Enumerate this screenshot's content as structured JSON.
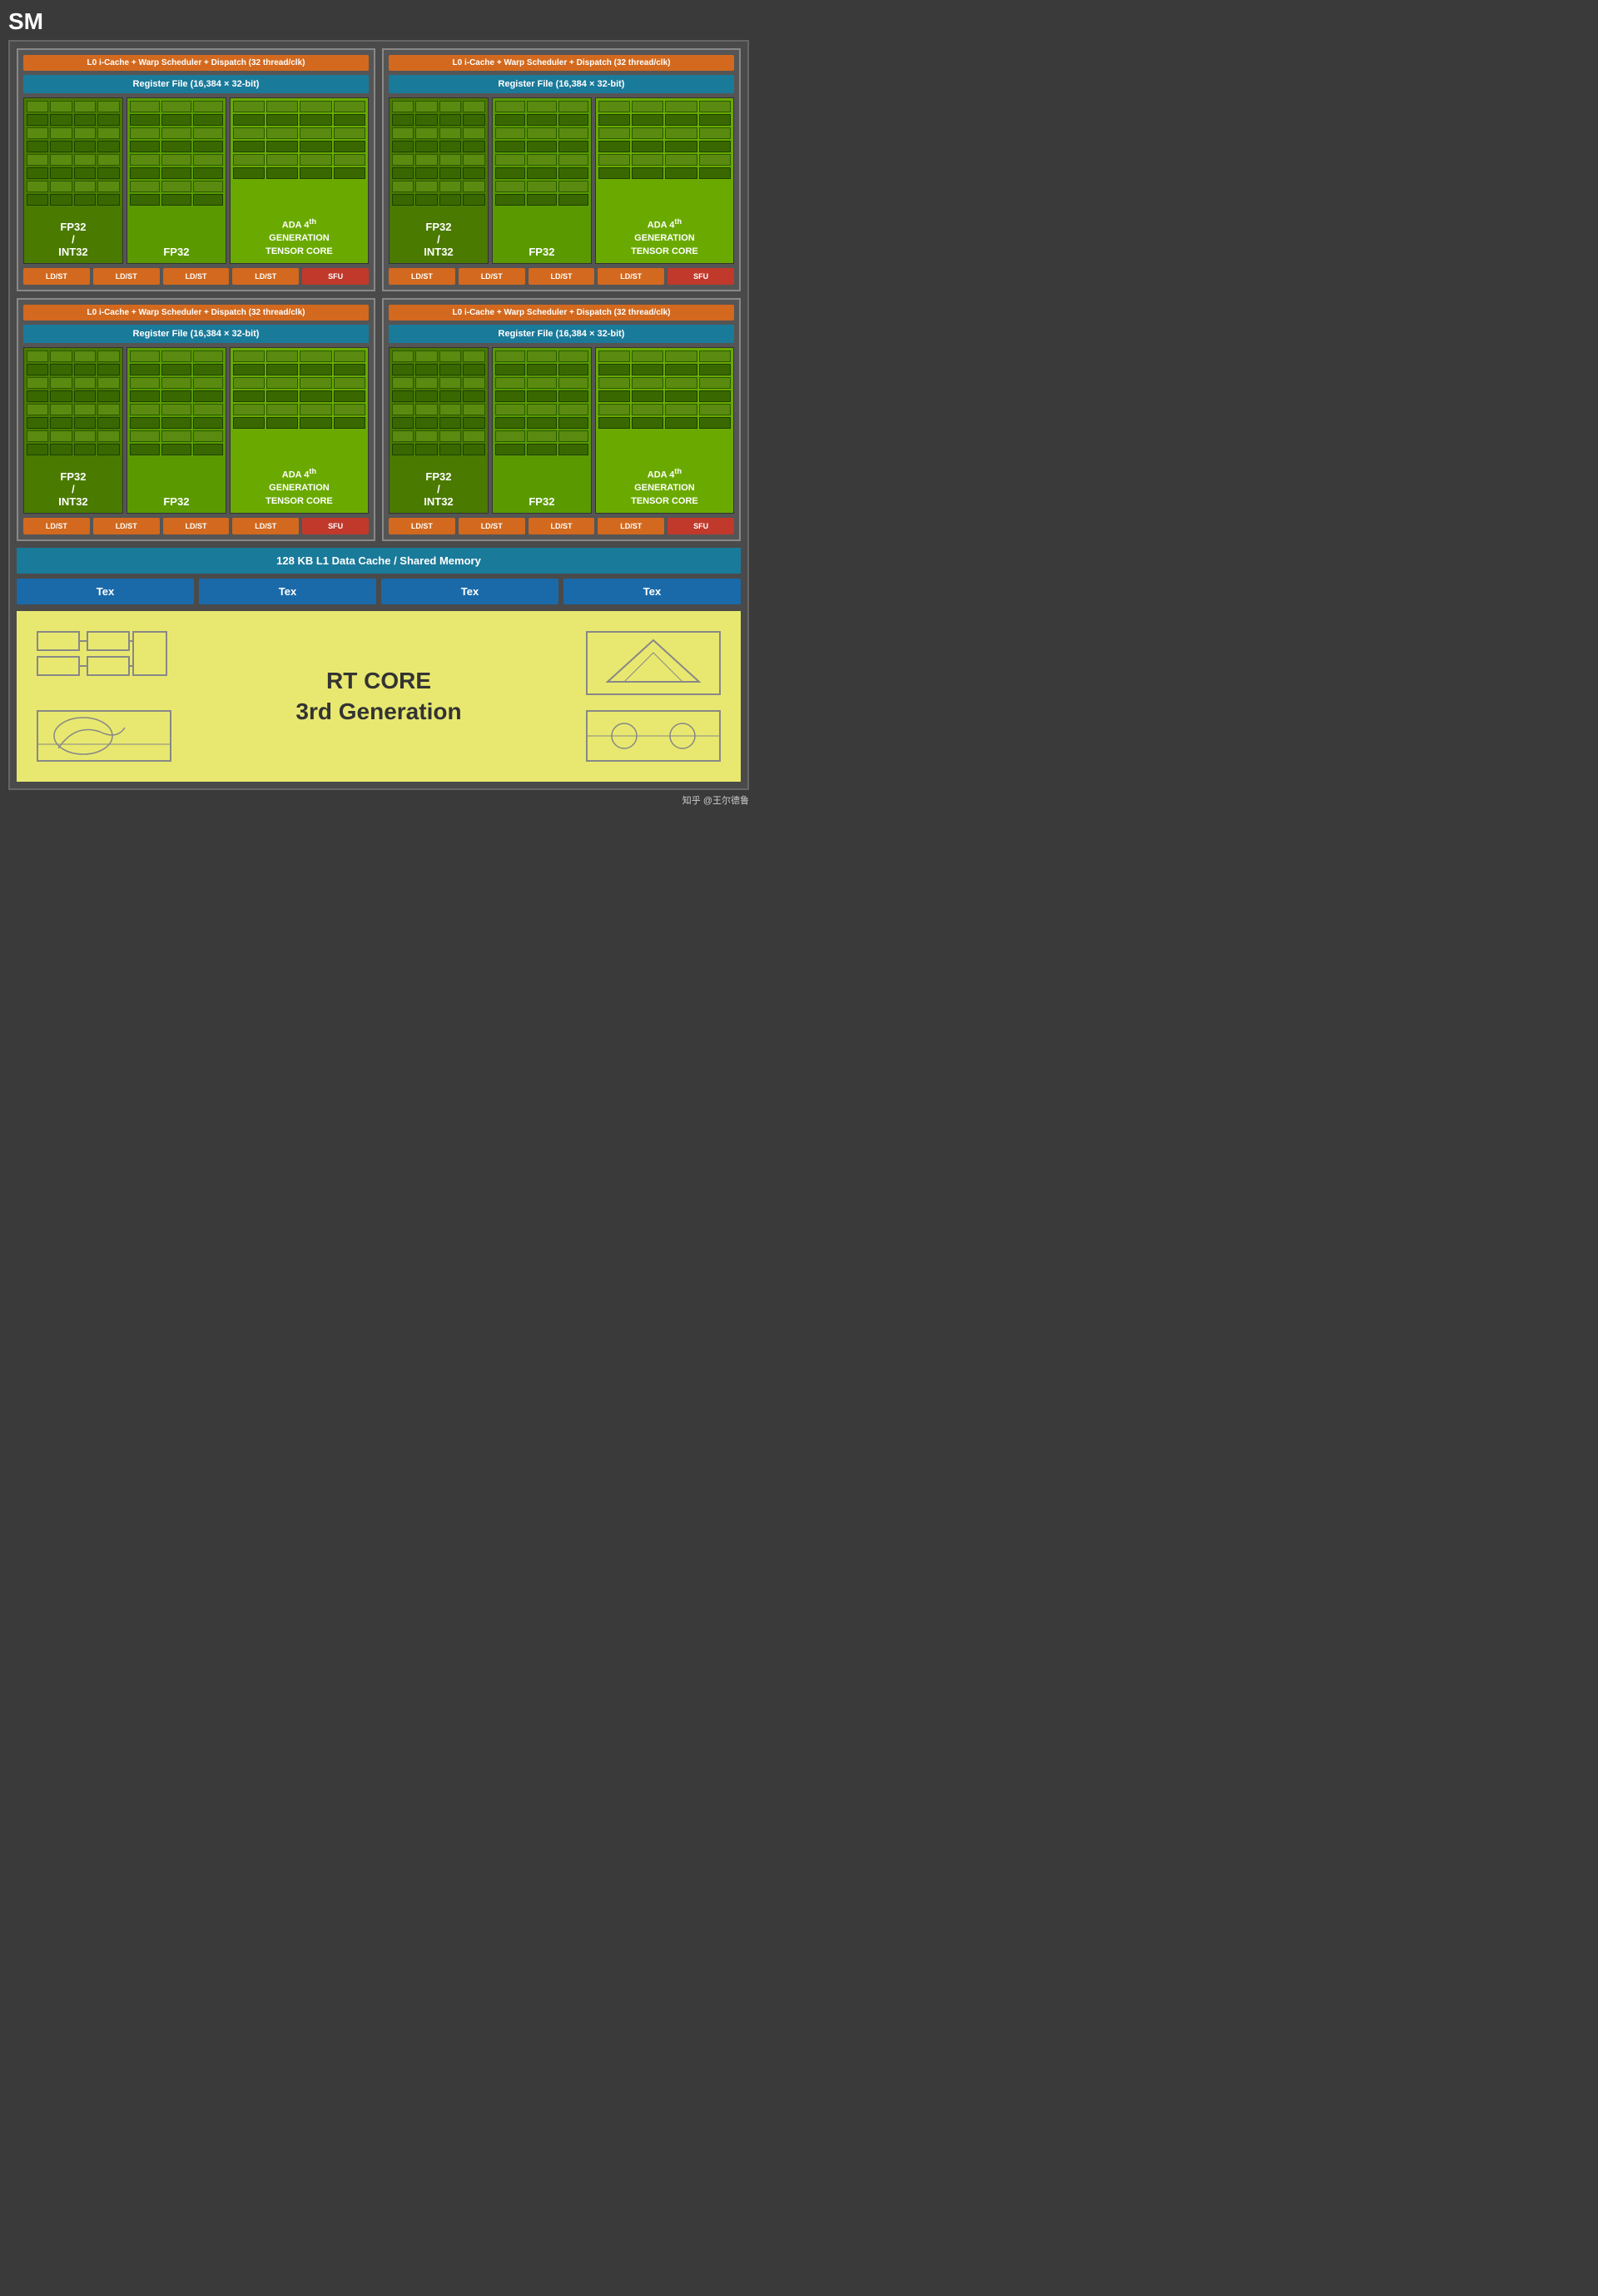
{
  "sm_label": "SM",
  "quadrants": [
    {
      "id": "q1",
      "warp_scheduler": "L0 i-Cache + Warp Scheduler + Dispatch (32 thread/clk)",
      "register_file": "Register File (16,384 × 32-bit)",
      "fp32_int32_label": "FP32\n/\nINT32",
      "fp32_label": "FP32",
      "tensor_label": "ADA 4th\nGENERATION\nTENSOR CORE",
      "ldst_labels": [
        "LD/ST",
        "LD/ST",
        "LD/ST",
        "LD/ST"
      ],
      "sfu_label": "SFU"
    },
    {
      "id": "q2",
      "warp_scheduler": "L0 i-Cache + Warp Scheduler + Dispatch (32 thread/clk)",
      "register_file": "Register File (16,384 × 32-bit)",
      "fp32_int32_label": "FP32\n/\nINT32",
      "fp32_label": "FP32",
      "tensor_label": "ADA 4th\nGENERATION\nTENSOR CORE",
      "ldst_labels": [
        "LD/ST",
        "LD/ST",
        "LD/ST",
        "LD/ST"
      ],
      "sfu_label": "SFU"
    },
    {
      "id": "q3",
      "warp_scheduler": "L0 i-Cache + Warp Scheduler + Dispatch (32 thread/clk)",
      "register_file": "Register File (16,384 × 32-bit)",
      "fp32_int32_label": "FP32\n/\nINT32",
      "fp32_label": "FP32",
      "tensor_label": "ADA 4th\nGENERATION\nTENSOR CORE",
      "ldst_labels": [
        "LD/ST",
        "LD/ST",
        "LD/ST",
        "LD/ST"
      ],
      "sfu_label": "SFU"
    },
    {
      "id": "q4",
      "warp_scheduler": "L0 i-Cache + Warp Scheduler + Dispatch (32 thread/clk)",
      "register_file": "Register File (16,384 × 32-bit)",
      "fp32_int32_label": "FP32\n/\nINT32",
      "fp32_label": "FP32",
      "tensor_label": "ADA 4th\nGENERATION\nTENSOR CORE",
      "ldst_labels": [
        "LD/ST",
        "LD/ST",
        "LD/ST",
        "LD/ST"
      ],
      "sfu_label": "SFU"
    }
  ],
  "l1_cache": "128 KB L1 Data Cache / Shared Memory",
  "tex_units": [
    "Tex",
    "Tex",
    "Tex",
    "Tex"
  ],
  "rt_core": {
    "label_line1": "RT CORE",
    "label_line2": "3rd Generation"
  },
  "watermark": "知乎 @王尔德鲁"
}
